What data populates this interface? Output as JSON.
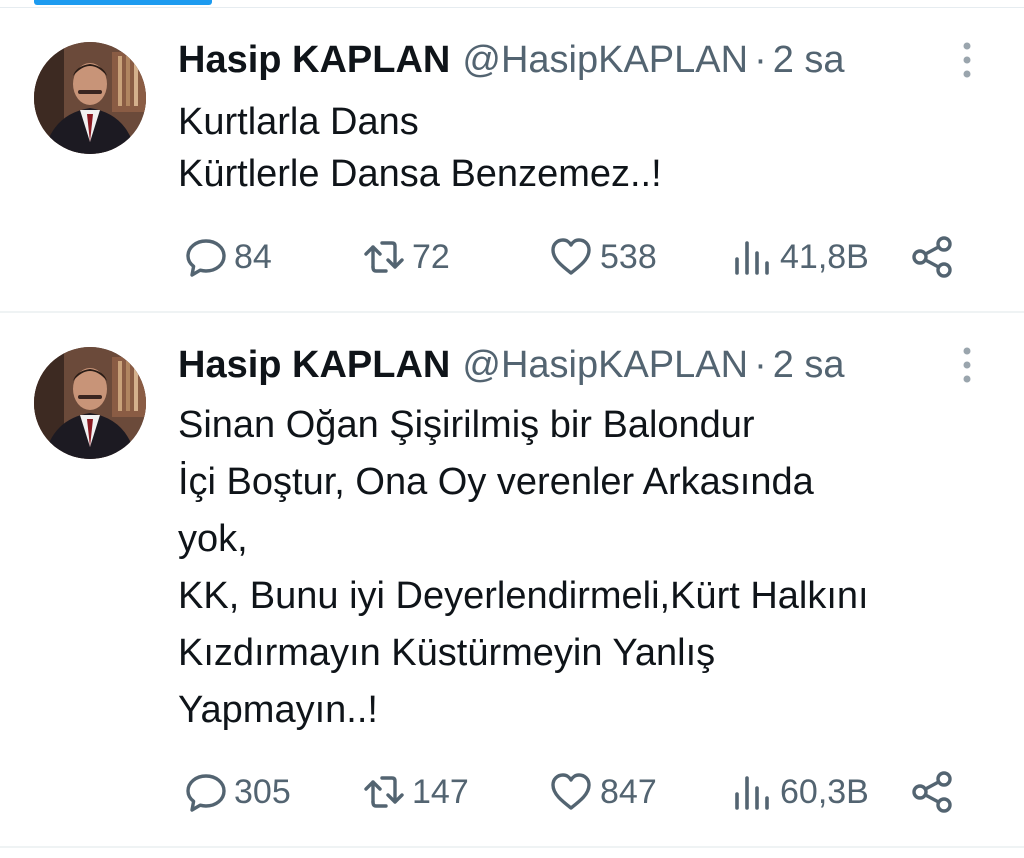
{
  "tweets": [
    {
      "name": "Hasip KAPLAN",
      "handle": "@HasipKAPLAN",
      "separator": "·",
      "time": "2 sa",
      "lines": [
        "Kurtlarla Dans",
        "Kürtlerle Dansa Benzemez..!"
      ],
      "replies": "84",
      "retweets": "72",
      "likes": "538",
      "views": "41,8B"
    },
    {
      "name": "Hasip KAPLAN",
      "handle": "@HasipKAPLAN",
      "separator": "·",
      "time": "2 sa",
      "lines": [
        "Sinan Oğan Şişirilmiş bir Balondur",
        "İçi Boştur, Ona Oy verenler Arkasında",
        "yok,",
        "KK, Bunu iyi Deyerlendirmeli,Kürt Halkını",
        "Kızdırmayın Küstürmeyin Yanlış",
        "Yapmayın..!"
      ],
      "replies": "305",
      "retweets": "147",
      "likes": "847",
      "views": "60,3B"
    }
  ],
  "icons": {
    "reply": "speech-bubble-icon",
    "retweet": "retweet-arrows-icon",
    "like": "heart-icon",
    "views": "bar-chart-icon",
    "share": "share-icon",
    "more": "vertical-dots-icon"
  },
  "colors": {
    "text": "#0f1419",
    "secondary": "#536471",
    "accent": "#1d9bf0",
    "divider": "#eff3f4"
  }
}
